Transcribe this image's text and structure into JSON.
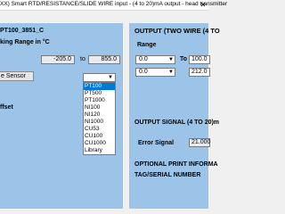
{
  "window": {
    "title": "XX) Smart RTD/RESISTANCE/SLIDE WIRE input - (4 to 20)mA output - head transmitter",
    "close_glyph": "✕"
  },
  "left_panel": {
    "sensor_id": "PT100_3851_C",
    "working_range_label": "king Range in °C",
    "range_low": "-205.0",
    "range_to": "to",
    "range_high": "855.0",
    "sensor_button_label": "e Sensor",
    "offset_label": "ffset",
    "sensor_dropdown": {
      "selected": "",
      "options": [
        "PT100",
        "PT500",
        "PT1000",
        "NI100",
        "NI120",
        "NI1000",
        "CU53",
        "CU100",
        "CU1000",
        "Library"
      ],
      "highlighted_index": 0
    }
  },
  "right_panel": {
    "title": "OUTPUT (TWO WIRE (4 TO",
    "range_label": "Range",
    "row1_low": "0.0",
    "row1_to": "To",
    "row1_high": "100.0",
    "row2_low": "0.0",
    "row2_high": "212.0",
    "signal_title": "OUTPUT SIGNAL (4 TO 20)m",
    "error_signal_label": "Error Signal",
    "error_signal_value": "21.000",
    "print_title": "OPTIONAL PRINT INFORMA",
    "tag_label": "TAG/SERIAL NUMBER"
  },
  "colors": {
    "panel_bg": "#9cc4e8",
    "window_bg": "#f0f0f0",
    "selection": "#0078d7"
  }
}
